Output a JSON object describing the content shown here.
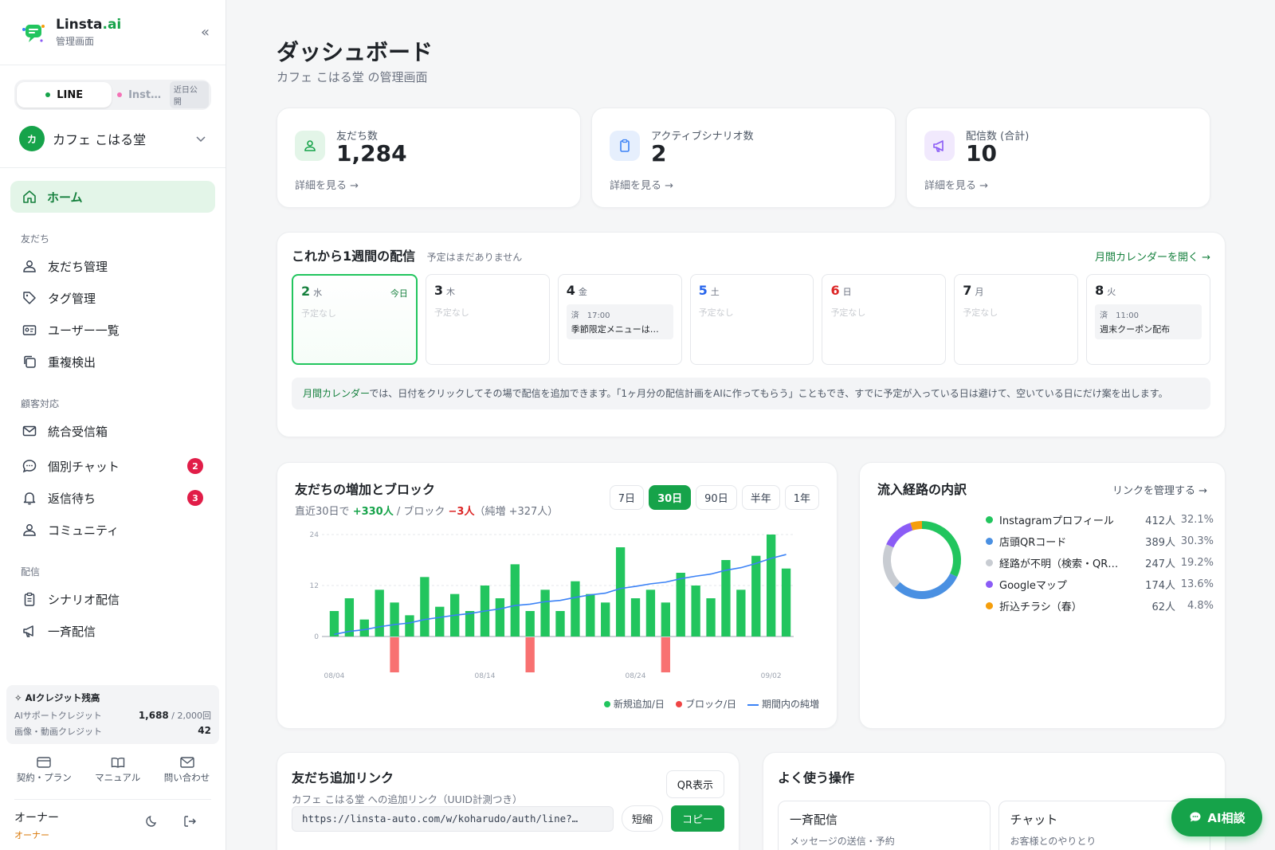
{
  "brand": {
    "name": "Linsta",
    "name_suffix": ".ai",
    "subtitle": "管理画面"
  },
  "platform_tabs": [
    {
      "label": "LINE",
      "active": true,
      "dot_color": "#16a34a"
    },
    {
      "label": "Inst…",
      "active": false,
      "dot_color": "#f472b6",
      "badge": "近日公開"
    }
  ],
  "account": {
    "avatar": "カ",
    "name": "カフェ こはる堂"
  },
  "nav": {
    "home": "ホーム",
    "sections": [
      {
        "title": "友だち",
        "items": [
          {
            "label": "友だち管理",
            "icon": "users-icon"
          },
          {
            "label": "タグ管理",
            "icon": "tag-icon"
          },
          {
            "label": "ユーザー一覧",
            "icon": "id-card-icon"
          },
          {
            "label": "重複検出",
            "icon": "copy-icon"
          }
        ]
      },
      {
        "title": "顧客対応",
        "items": [
          {
            "label": "統合受信箱",
            "icon": "mail-icon"
          },
          {
            "label": "個別チャット",
            "icon": "chat-icon",
            "badge": "2"
          },
          {
            "label": "返信待ち",
            "icon": "bell-icon",
            "badge": "3"
          },
          {
            "label": "コミュニティ",
            "icon": "users-icon"
          }
        ]
      },
      {
        "title": "配信",
        "items": [
          {
            "label": "シナリオ配信",
            "icon": "clipboard-icon"
          },
          {
            "label": "一斉配信",
            "icon": "megaphone-icon"
          }
        ]
      }
    ]
  },
  "credits": {
    "title": "AIクレジット残高",
    "rows": [
      {
        "label": "AIサポートクレジット",
        "value": "1,688",
        "denom": " / 2,000回"
      },
      {
        "label": "画像・動画クレジット",
        "value": "42",
        "denom": ""
      }
    ]
  },
  "footer_links": [
    {
      "label": "契約・プラン",
      "icon": "card-icon"
    },
    {
      "label": "マニュアル",
      "icon": "book-icon"
    },
    {
      "label": "問い合わせ",
      "icon": "mail-icon"
    }
  ],
  "owner": {
    "name": "オーナー",
    "role": "オーナー"
  },
  "page": {
    "title": "ダッシュボード",
    "subtitle": "カフェ こはる堂 の管理画面"
  },
  "stats": [
    {
      "label": "友だち数",
      "value": "1,284",
      "more": "詳細を見る →",
      "icon": "users-icon",
      "bg": "#e3f5e8",
      "fg": "#16a34a"
    },
    {
      "label": "アクティブシナリオ数",
      "value": "2",
      "more": "詳細を見る →",
      "icon": "clipboard-icon",
      "bg": "#e6effd",
      "fg": "#3b82f6"
    },
    {
      "label": "配信数 (合計)",
      "value": "10",
      "more": "詳細を見る →",
      "icon": "megaphone-icon",
      "bg": "#f1e9fd",
      "fg": "#8b5cf6"
    }
  ],
  "week": {
    "title": "これから1週間の配信",
    "subtitle": "予定はまだありません",
    "calendar_link": "月間カレンダーを開く →",
    "days": [
      {
        "num": "2",
        "wd": "水",
        "color": "#15803d",
        "today": true,
        "today_label": "今日",
        "none": "予定なし"
      },
      {
        "num": "3",
        "wd": "木",
        "color": "#1f2328",
        "none": "予定なし"
      },
      {
        "num": "4",
        "wd": "金",
        "color": "#1f2328",
        "event": {
          "meta": "済　17:00",
          "title": "季節限定メニューは…"
        }
      },
      {
        "num": "5",
        "wd": "土",
        "color": "#2563eb",
        "none": "予定なし"
      },
      {
        "num": "6",
        "wd": "日",
        "color": "#dc2626",
        "none": "予定なし"
      },
      {
        "num": "7",
        "wd": "月",
        "color": "#1f2328",
        "none": "予定なし"
      },
      {
        "num": "8",
        "wd": "火",
        "color": "#1f2328",
        "event": {
          "meta": "済　11:00",
          "title": "週末クーポン配布"
        }
      }
    ],
    "note_highlight": "月間カレンダー",
    "note_text": "では、日付をクリックしてその場で配信を追加できます。「1ヶ月分の配信計画をAIに作ってもらう」こともでき、すでに予定が入っている日は避けて、空いている日にだけ案を出します。"
  },
  "growth": {
    "title": "友だちの増加とブロック",
    "sub_prefix": "直近30日で ",
    "plus": "+330人",
    "sub_mid": " / ブロック ",
    "minus": "−3人",
    "sub_suffix": "（純増 +327人）",
    "ranges": [
      {
        "label": "7日",
        "active": false
      },
      {
        "label": "30日",
        "active": true
      },
      {
        "label": "90日",
        "active": false
      },
      {
        "label": "半年",
        "active": false
      },
      {
        "label": "1年",
        "active": false
      }
    ],
    "legend": {
      "new": "新規追加/日",
      "block": "ブロック/日",
      "net": "期間内の純増"
    }
  },
  "chart_data": {
    "type": "bar",
    "colors": {
      "new": "#22c55e",
      "block": "#f87171",
      "net": "#3b82f6"
    },
    "ylim": [
      0,
      24
    ],
    "yticks": [
      0,
      12,
      24
    ],
    "x_tick_labels": [
      "08/04",
      "08/14",
      "08/24",
      "09/02"
    ],
    "x_tick_index": [
      0,
      10,
      20,
      29
    ],
    "series": [
      {
        "name": "新規追加/日",
        "values": [
          6,
          9,
          4,
          11,
          8,
          5,
          14,
          7,
          10,
          6,
          12,
          9,
          17,
          6,
          11,
          6,
          13,
          10,
          8,
          21,
          9,
          11,
          8,
          15,
          12,
          9,
          18,
          11,
          19,
          24,
          16
        ]
      },
      {
        "name": "ブロック/日",
        "values": [
          0,
          0,
          0,
          0,
          1,
          0,
          0,
          0,
          0,
          0,
          0,
          0,
          0,
          1,
          0,
          0,
          0,
          0,
          0,
          0,
          0,
          0,
          1,
          0,
          0,
          0,
          0,
          0,
          0,
          0,
          0
        ]
      },
      {
        "name": "期間内の純増",
        "values": [
          0.5,
          1.2,
          1.6,
          2.3,
          2.8,
          3.2,
          4.0,
          4.5,
          5.0,
          5.4,
          6.0,
          6.5,
          7.3,
          7.6,
          8.2,
          8.5,
          9.2,
          9.8,
          10.2,
          11.3,
          11.8,
          12.4,
          12.8,
          13.6,
          14.2,
          14.7,
          15.6,
          16.2,
          17.2,
          18.4,
          19.3
        ]
      }
    ]
  },
  "sources": {
    "title": "流入経路の内訳",
    "link": "リンクを管理する →",
    "items": [
      {
        "name": "Instagramプロフィール",
        "count": "412人",
        "pct": "32.1%",
        "value": 32.1,
        "color": "#22c55e"
      },
      {
        "name": "店頭QRコード",
        "count": "389人",
        "pct": "30.3%",
        "value": 30.3,
        "color": "#4a90e2"
      },
      {
        "name": "経路が不明（検索・QR…",
        "count": "247人",
        "pct": "19.2%",
        "value": 19.2,
        "color": "#c8ccd2"
      },
      {
        "name": "Googleマップ",
        "count": "174人",
        "pct": "13.6%",
        "value": 13.6,
        "color": "#8b5cf6"
      },
      {
        "name": "折込チラシ（春）",
        "count": "62人",
        "pct": "4.8%",
        "value": 4.8,
        "color": "#f59e0b"
      }
    ]
  },
  "links_card": {
    "title": "友だち追加リンク",
    "subtitle": "カフェ こはる堂 への追加リンク（UUID計測つき）",
    "qr_label": "QR表示",
    "url": "https://linsta-auto.com/w/koharudo/auth/line?…",
    "short_label": "短縮",
    "copy_label": "コピー"
  },
  "quick": {
    "title": "よく使う操作",
    "actions": [
      {
        "title": "一斉配信",
        "sub": "メッセージの送信・予約"
      },
      {
        "title": "チャット",
        "sub": "お客様とのやりとり"
      }
    ]
  },
  "ai_button": "AI相談"
}
